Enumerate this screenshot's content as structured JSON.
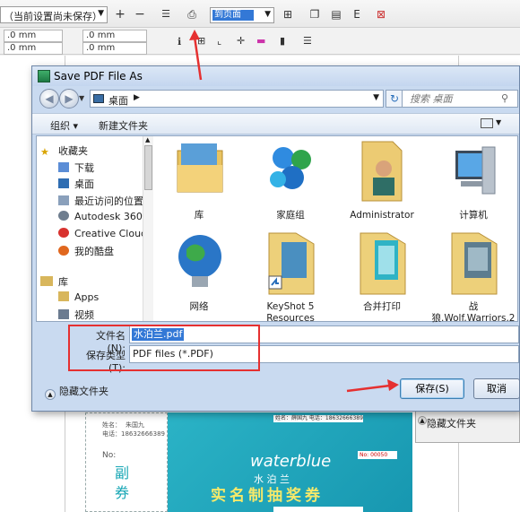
{
  "app": {
    "preset_value": "（当前设置尚未保存）",
    "page_select_value": "到页面",
    "field1_value": ".0 mm",
    "field2_value": ".0 mm",
    "field3_value": ".0 mm",
    "field4_value": ".0 mm"
  },
  "dialog": {
    "title": "Save PDF File As",
    "breadcrumb": "桌面",
    "search_placeholder": "搜索 桌面",
    "organize_label": "组织 ▾",
    "new_folder_label": "新建文件夹",
    "nav_items": [
      {
        "label": "收藏夹"
      },
      {
        "label": "下载"
      },
      {
        "label": "桌面"
      },
      {
        "label": "最近访问的位置"
      },
      {
        "label": "Autodesk 360"
      },
      {
        "label": "Creative Cloud"
      },
      {
        "label": "我的酷盘"
      },
      {
        "label": "库"
      },
      {
        "label": "Apps"
      },
      {
        "label": "视频"
      }
    ],
    "files": [
      {
        "label": "库"
      },
      {
        "label": "家庭组"
      },
      {
        "label": "Administrator"
      },
      {
        "label": "计算机"
      },
      {
        "label": "网络"
      },
      {
        "label": "KeyShot 5 Resources"
      },
      {
        "label": "合并打印"
      },
      {
        "label": "战狼.Wolf.Warriors.2"
      }
    ],
    "filename_label": "文件名(N):",
    "filename_value": "水泊兰.pdf",
    "filetype_label": "保存类型(T):",
    "filetype_value": "PDF files (*.PDF)",
    "hide_folders_label": "隐藏文件夹",
    "save_label": "保存(S)",
    "cancel_label": "取消"
  },
  "background_ticket": {
    "left_name": "姓名：",
    "left_name_value": "朱国九",
    "left_phone": "电话：18632666389",
    "left_no": "No:",
    "left_title": "副\n券",
    "strip_text": "姓名：薛国九    电话：18632666389",
    "brand": "waterblue",
    "brand_cn": "水 泊 兰",
    "headline": "实名制抽奖券",
    "number_label": "No:",
    "number_value": "00050",
    "side_hide_label": "隐藏文件夹"
  },
  "colors": {
    "accent": "#3378d6",
    "highlight": "#e53030",
    "ticket": "#1fa5bb"
  }
}
